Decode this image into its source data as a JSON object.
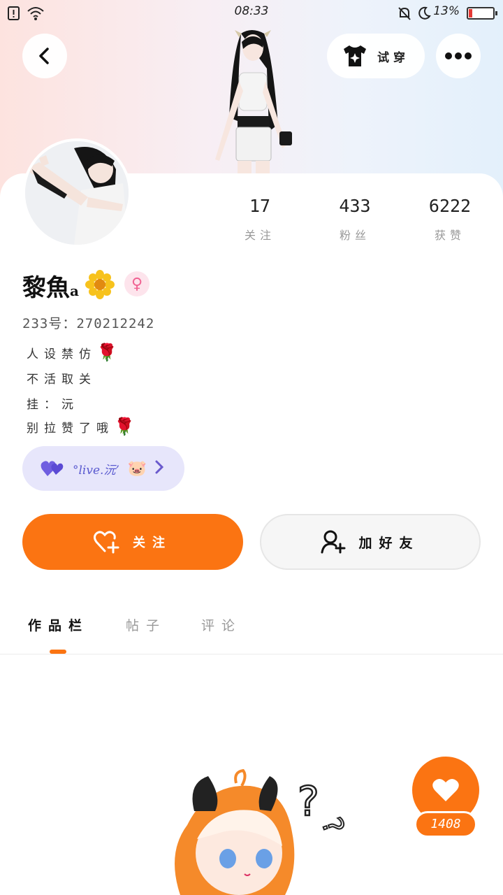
{
  "status_bar": {
    "time": "08:33",
    "battery_percent_text": "13%",
    "battery_level": 0.13,
    "battery_color": "#e53935",
    "icons": [
      "sim-alert-icon",
      "wifi-icon",
      "mute-bell-icon",
      "moon-icon",
      "battery-icon"
    ]
  },
  "header": {
    "back_icon": "chevron-left-icon",
    "try_on_label": "试穿",
    "try_on_icon": "tshirt-sparkle-icon",
    "more_icon": "ellipsis-icon"
  },
  "profile": {
    "stats": [
      {
        "value": "17",
        "label": "关注"
      },
      {
        "value": "433",
        "label": "粉丝"
      },
      {
        "value": "6222",
        "label": "获赞"
      }
    ],
    "name": "黎魚",
    "name_suffix": "a",
    "gender_symbol": "♀",
    "uid": "233号：270212242",
    "bio": [
      {
        "text": "人设禁仿",
        "emoji": "🌹"
      },
      {
        "text": "不活取关",
        "emoji": ""
      },
      {
        "text": "挂：沅",
        "emoji": ""
      },
      {
        "text": "别拉赞了哦",
        "emoji": "🌹"
      }
    ],
    "club": {
      "label": "°live.沅’",
      "emoji": "🐷"
    }
  },
  "actions": {
    "follow_label": "关注",
    "add_friend_label": "加好友"
  },
  "tabs": [
    {
      "label": "作品栏",
      "active": true
    },
    {
      "label": "帖子",
      "active": false
    },
    {
      "label": "评论",
      "active": false
    }
  ],
  "like_count": "1408",
  "colors": {
    "accent": "#fb7412",
    "club_bg": "#e7e6fb",
    "gender_bg": "#fde4ec"
  }
}
